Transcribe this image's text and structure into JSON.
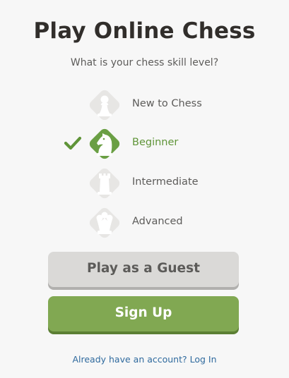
{
  "header": {
    "title": "Play Online Chess",
    "subtitle": "What is your chess skill level?"
  },
  "levels": [
    {
      "label": "New to Chess",
      "icon": "pawn-icon",
      "selected": false
    },
    {
      "label": "Beginner",
      "icon": "knight-icon",
      "selected": true
    },
    {
      "label": "Intermediate",
      "icon": "rook-icon",
      "selected": false
    },
    {
      "label": "Advanced",
      "icon": "king-icon",
      "selected": false
    }
  ],
  "actions": {
    "guest_label": "Play as a Guest",
    "signup_label": "Sign Up",
    "login_link": "Already have an account? Log In"
  },
  "colors": {
    "accent_green": "#81a852",
    "selected_green": "#6a9f44",
    "guest_gray": "#dad9d7",
    "link_blue": "#2f6a9e"
  }
}
